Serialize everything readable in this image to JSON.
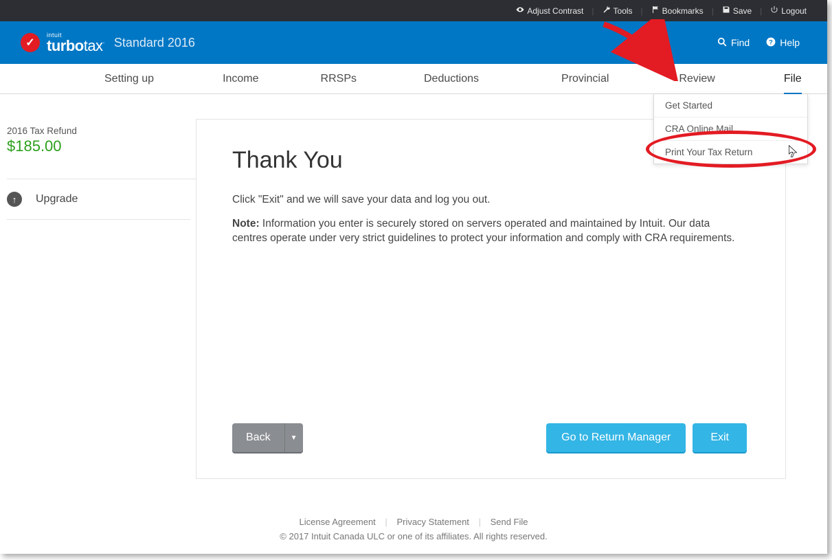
{
  "utilbar": {
    "adjust_contrast": "Adjust Contrast",
    "tools": "Tools",
    "bookmarks": "Bookmarks",
    "save": "Save",
    "logout": "Logout"
  },
  "brand": {
    "intuit": "intuit",
    "product": "turbotax",
    "edition": "Standard 2016",
    "find": "Find",
    "help": "Help"
  },
  "tabs": {
    "setting_up": "Setting up",
    "income": "Income",
    "rrsps": "RRSPs",
    "deductions": "Deductions",
    "provincial": "Provincial",
    "review": "Review",
    "file": "File"
  },
  "file_menu": {
    "get_started": "Get Started",
    "cra_mail": "CRA Online Mail",
    "print_return": "Print Your Tax Return"
  },
  "sidebar": {
    "refund_label": "2016 Tax Refund",
    "refund_amount": "$185.00",
    "upgrade": "Upgrade"
  },
  "main": {
    "heading": "Thank You",
    "p1": "Click \"Exit\" and we will save your data and log you out.",
    "note_label": "Note:",
    "note_body": " Information you enter is securely stored on servers operated and maintained by Intuit. Our data centres operate under very strict guidelines to protect your information and comply with CRA requirements.",
    "back": "Back",
    "goto_manager": "Go to Return Manager",
    "exit": "Exit"
  },
  "footer": {
    "license": "License Agreement",
    "privacy": "Privacy Statement",
    "sendfile": "Send File",
    "copyright": "© 2017 Intuit Canada ULC or one of its affiliates. All rights reserved."
  }
}
